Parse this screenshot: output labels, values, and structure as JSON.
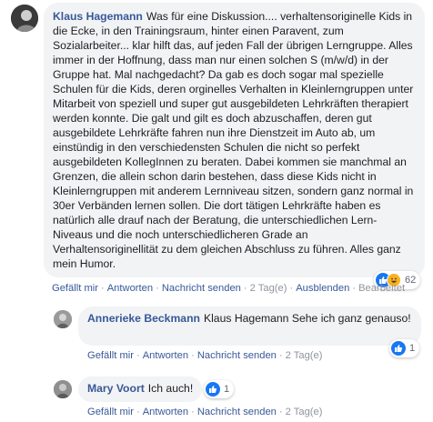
{
  "comments": [
    {
      "author": "Klaus Hagemann",
      "text": "Was für eine Diskussion.... verhaltensoriginelle Kids in die Ecke, in den Trainingsraum, hinter einen Paravent, zum Sozialarbeiter... klar hilft das, auf jeden Fall der übrigen Lerngruppe. Alles immer in der Hoffnung, dass man nur einen solchen S (m/w/d) in der Gruppe hat. Mal nachgedacht? Da gab es doch sogar mal spezielle Schulen für die Kids, deren orginelles Verhalten in Kleinlerngruppen unter Mitarbeit von speziell und super gut ausgebildeten Lehrkräften therapiert werden konnte. Die galt und gilt es doch abzuschaffen, deren gut ausgebildete Lehrkräfte fahren nun ihre Dienstzeit im Auto ab, um einstündig in den verschiedensten Schulen die nicht so perfekt ausgebildeten KollegInnen zu beraten. Dabei kommen sie manchmal an Grenzen, die allein schon darin bestehen, dass diese Kids nicht in Kleinlerngruppen mit anderem Lernniveau sitzen, sondern ganz normal in 30er Verbänden lernen sollen. Die dort tätigen Lehrkräfte haben es natürlich alle drauf nach der Beratung, die unterschiedlichen Lern-Niveaus und die noch unterschiedlicheren Grade an Verhaltensoriginellität zu dem gleichen Abschluss zu führen. Alles ganz mein Humor.",
      "reactions": {
        "icons": [
          "like-icon",
          "haha-icon"
        ],
        "count": "62"
      },
      "actions": {
        "like": "Gefällt mir",
        "reply": "Antworten",
        "message": "Nachricht senden",
        "time": "2 Tag(e)",
        "hide": "Ausblenden",
        "edited": "Bearbeitet"
      }
    },
    {
      "author": "Annerieke Beckmann",
      "text": "Klaus Hagemann Sehe ich ganz genauso!",
      "reactions": {
        "icons": [
          "like-icon"
        ],
        "count": "1"
      },
      "actions": {
        "like": "Gefällt mir",
        "reply": "Antworten",
        "message": "Nachricht senden",
        "time": "2 Tag(e)"
      }
    },
    {
      "author": "Mary Voort",
      "text": "Ich auch!",
      "reactions": {
        "icons": [
          "like-icon"
        ],
        "count": "1"
      },
      "actions": {
        "like": "Gefällt mir",
        "reply": "Antworten",
        "message": "Nachricht senden",
        "time": "2 Tag(e)"
      }
    }
  ],
  "separator": "·",
  "colors": {
    "link": "#385898",
    "bubble": "#f2f3f5",
    "meta": "#606770",
    "like_blue": "#1877f2",
    "haha_yellow": "#f7b125"
  }
}
